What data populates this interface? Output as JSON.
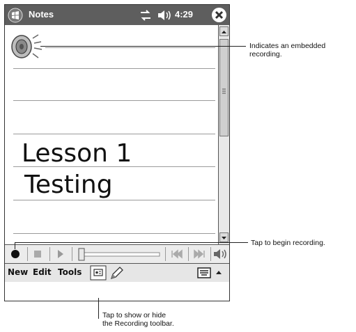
{
  "window": {
    "app_title": "Notes",
    "clock": "4:29"
  },
  "note": {
    "lines": [
      "Lesson 1",
      "Testing"
    ]
  },
  "menu": {
    "new_label": "New",
    "edit_label": "Edit",
    "tools_label": "Tools"
  },
  "callouts": {
    "embedded_line1": "Indicates an embedded",
    "embedded_line2": "recording.",
    "record": "Tap to begin recording.",
    "toolbar_line1": "Tap to show or hide",
    "toolbar_line2": "the Recording toolbar."
  },
  "icons": [
    "windows-start-icon",
    "connectivity-icon",
    "volume-icon",
    "close-icon",
    "speaker-icon",
    "record-icon",
    "stop-icon",
    "play-icon",
    "volume-slider",
    "skip-previous-icon",
    "skip-next-icon",
    "speaker-volume-icon",
    "recording-toolbar-icon",
    "pen-icon",
    "keyboard-icon",
    "sip-arrow-icon"
  ]
}
